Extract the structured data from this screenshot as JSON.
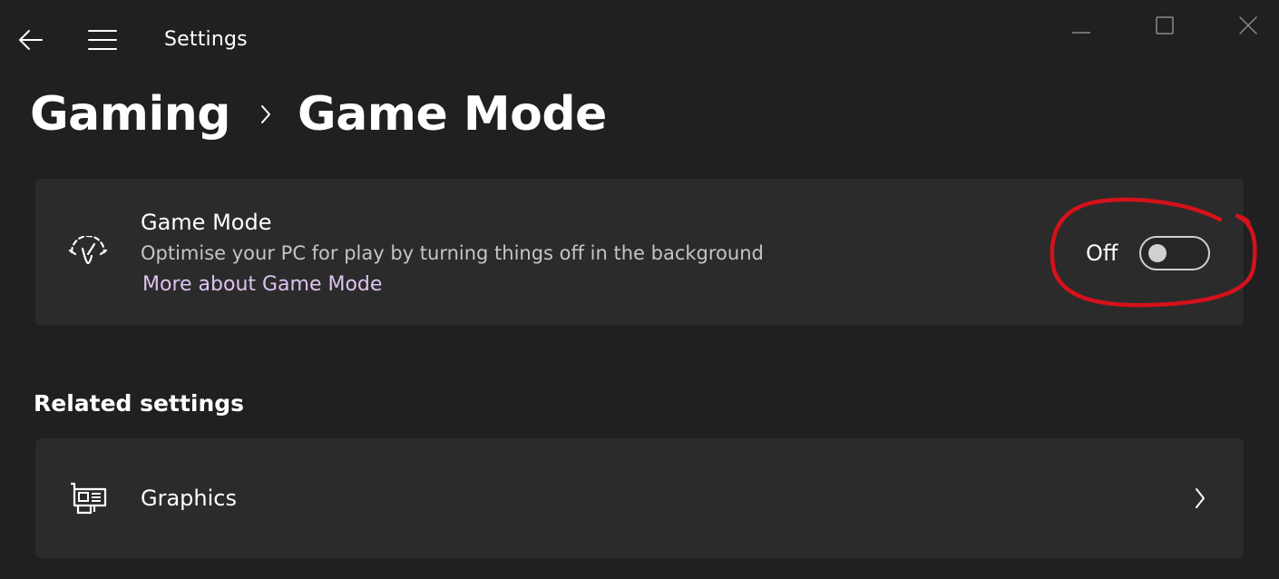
{
  "window": {
    "app_title": "Settings",
    "controls": {
      "minimize_icon": "minimize-icon",
      "maximize_icon": "maximize-icon",
      "close_icon": "close-icon"
    }
  },
  "nav": {
    "back_icon": "back-arrow-icon",
    "menu_icon": "hamburger-menu-icon"
  },
  "breadcrumb": {
    "parent": "Gaming",
    "separator_icon": "chevron-right-icon",
    "current": "Game Mode"
  },
  "game_mode_card": {
    "icon": "speedometer-icon",
    "title": "Game Mode",
    "description": "Optimise your PC for play by turning things off in the background",
    "link": "More about Game Mode",
    "toggle": {
      "state_label": "Off",
      "on": false
    },
    "annotation_color": "#d4121b"
  },
  "related_settings": {
    "heading": "Related settings",
    "items": [
      {
        "icon": "graphics-card-icon",
        "label": "Graphics",
        "chevron_icon": "chevron-right-icon"
      }
    ]
  },
  "colors": {
    "background": "#202020",
    "card": "#2b2b2b",
    "link": "#dcc3f0",
    "secondary_text": "#c5c5c5"
  }
}
